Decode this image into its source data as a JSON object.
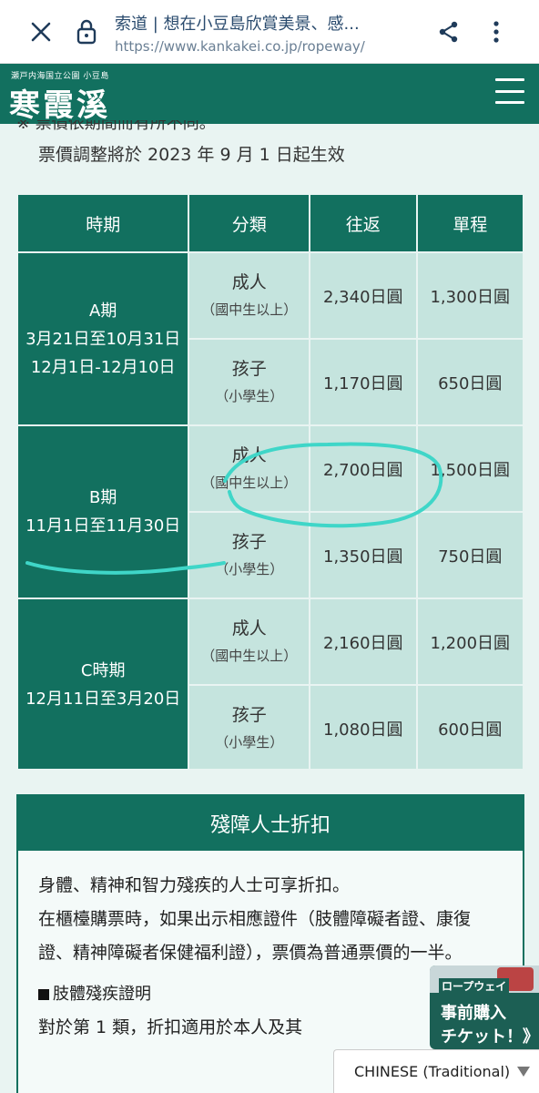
{
  "browser": {
    "title": "索道 | 想在小豆島欣賞美景、感...",
    "url": "https://www.kankakei.co.jp/ropeway/"
  },
  "site": {
    "sub": "瀬戸内海国立公園 小豆島",
    "logo": "寒霞溪"
  },
  "notes": {
    "cut_line": "※ 票價依期間而有所不同。",
    "effective": "票價調整將於 2023 年 9 月 1 日起生效"
  },
  "table": {
    "headers": [
      "時期",
      "分類",
      "往返",
      "單程"
    ],
    "periods": [
      {
        "lines": [
          "A期",
          "3月21日至10月31日",
          "12月1日-12月10日"
        ],
        "rows": [
          {
            "cat": "成人",
            "sub": "（國中生以上）",
            "round": "2,340日圓",
            "single": "1,300日圓"
          },
          {
            "cat": "孩子",
            "sub": "（小學生）",
            "round": "1,170日圓",
            "single": "650日圓"
          }
        ]
      },
      {
        "lines": [
          "B期",
          "11月1日至11月30日"
        ],
        "rows": [
          {
            "cat": "成人",
            "sub": "（國中生以上）",
            "round": "2,700日圓",
            "single": "1,500日圓"
          },
          {
            "cat": "孩子",
            "sub": "（小學生）",
            "round": "1,350日圓",
            "single": "750日圓"
          }
        ]
      },
      {
        "lines": [
          "C時期",
          "12月11日至3月20日"
        ],
        "rows": [
          {
            "cat": "成人",
            "sub": "（國中生以上）",
            "round": "2,160日圓",
            "single": "1,200日圓"
          },
          {
            "cat": "孩子",
            "sub": "（小學生）",
            "round": "1,080日圓",
            "single": "600日圓"
          }
        ]
      }
    ]
  },
  "discount": {
    "title": "殘障人士折扣",
    "p1": "身體、精神和智力殘疾的人士可享折扣。",
    "p2": "在櫃檯購票時，如果出示相應證件（肢體障礙者證、康復證、精神障礙者保健福利證），票價為普通票價的一半。",
    "label": "肢體殘疾證明",
    "p3": "對於第 1 類，折扣適用於本人及其"
  },
  "ticket": {
    "sub": "ロープウェイ",
    "line1": "事前購入",
    "line2": "チケット！》"
  },
  "language": {
    "selected": "CHINESE (Traditional)"
  },
  "colors": {
    "brand": "#12705f",
    "cell": "#c5e4de",
    "annotation": "#3fd6c8"
  }
}
